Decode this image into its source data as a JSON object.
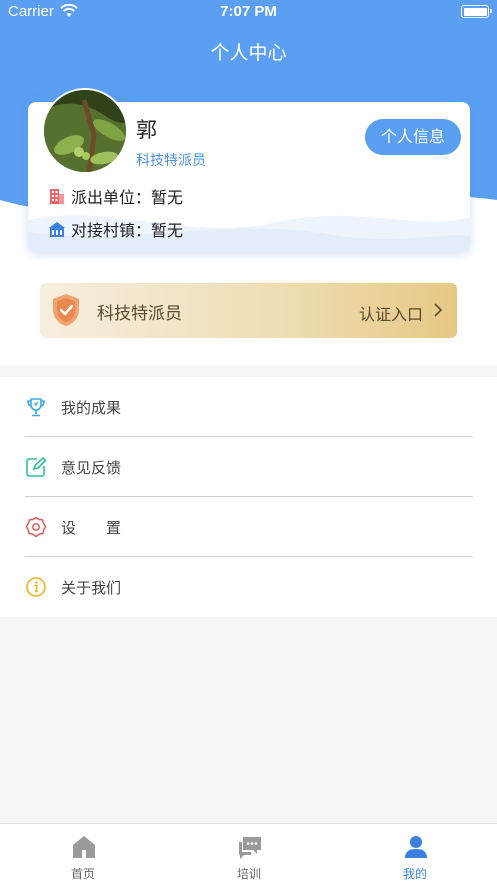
{
  "status_bar": {
    "carrier": "Carrier",
    "time": "7:07 PM"
  },
  "nav": {
    "title": "个人中心"
  },
  "profile": {
    "name": "郭",
    "role": "科技特派员",
    "info_button": "个人信息",
    "unit_label": "派出单位：暂无",
    "village_label": "对接村镇：暂无"
  },
  "certification": {
    "title": "科技特派员",
    "link": "认证入口"
  },
  "menu": {
    "items": [
      {
        "label": "我的成果",
        "icon": "trophy-icon"
      },
      {
        "label": "意见反馈",
        "icon": "edit-icon"
      },
      {
        "label": "设　　置",
        "icon": "settings-icon"
      },
      {
        "label": "关于我们",
        "icon": "info-icon"
      }
    ]
  },
  "tabbar": {
    "tabs": [
      {
        "label": "首页",
        "icon": "home-icon"
      },
      {
        "label": "培训",
        "icon": "chat-icon"
      },
      {
        "label": "我的",
        "icon": "user-icon"
      }
    ],
    "active_tab": "我的"
  },
  "colors": {
    "primary": "#5b9ff3",
    "active_tab": "#3b82e0",
    "gold_text": "#5a4a2e",
    "shield": "#e8874e"
  }
}
